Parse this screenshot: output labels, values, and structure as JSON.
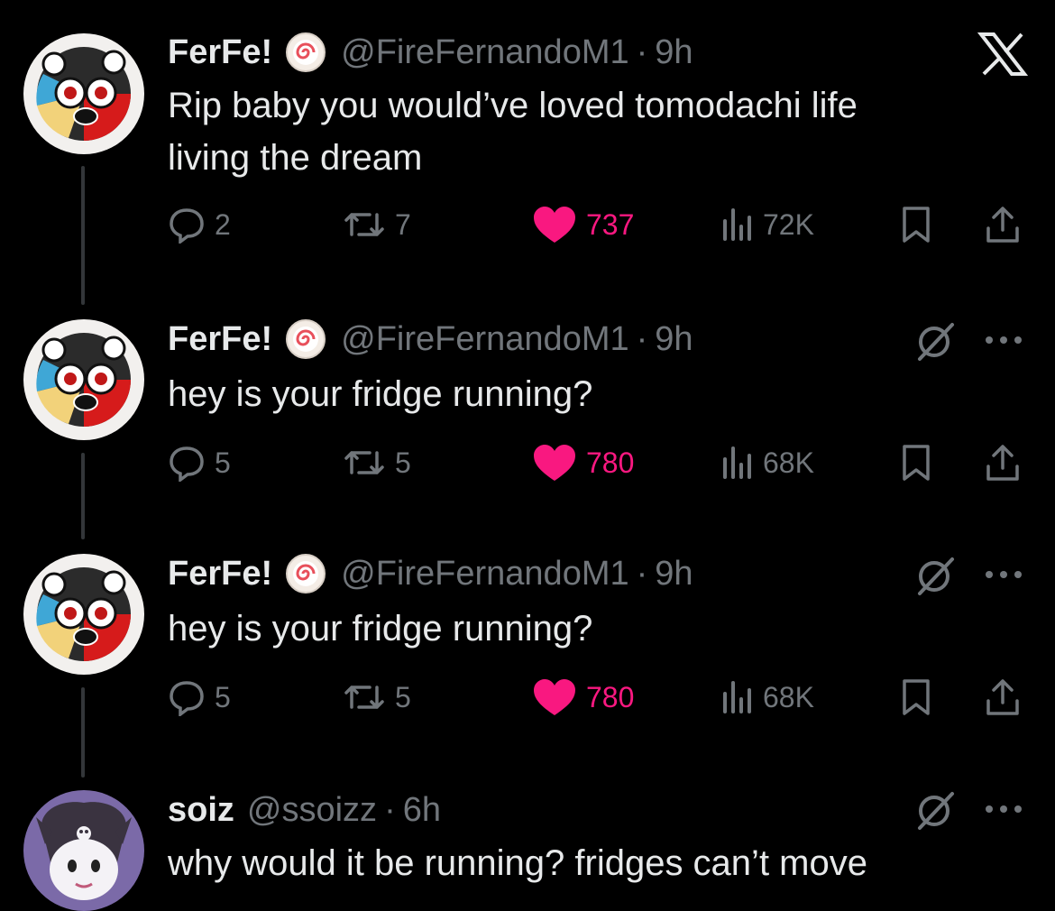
{
  "close_label": "X",
  "colors": {
    "like": "#f91880",
    "muted": "#71767b",
    "text": "#e7e9ea",
    "background": "#000000"
  },
  "tweets": [
    {
      "name": "FerFe!",
      "handle": "@FireFernandoM1",
      "dot": "·",
      "time": "9h",
      "text_lines": [
        "Rip baby you would’ve loved tomodachi life",
        "living the dream"
      ],
      "replies": "2",
      "reposts": "7",
      "likes": "737",
      "views": "72K",
      "liked": true,
      "corner": "x-logo-icon"
    },
    {
      "name": "FerFe!",
      "handle": "@FireFernandoM1",
      "dot": "·",
      "time": "9h",
      "text_lines": [
        "hey is your fridge running?"
      ],
      "replies": "5",
      "reposts": "5",
      "likes": "780",
      "views": "68K",
      "liked": true,
      "corner": "grok-icon"
    },
    {
      "name": "FerFe!",
      "handle": "@FireFernandoM1",
      "dot": "·",
      "time": "9h",
      "text_lines": [
        "hey is your fridge running?"
      ],
      "replies": "5",
      "reposts": "5",
      "likes": "780",
      "views": "68K",
      "liked": true,
      "corner": "grok-icon"
    },
    {
      "name": "soiz",
      "handle": "@ssoizz",
      "dot": "·",
      "time": "6h",
      "text_lines": [
        "why would it be running? fridges can’t move"
      ],
      "corner": "grok-icon"
    }
  ]
}
